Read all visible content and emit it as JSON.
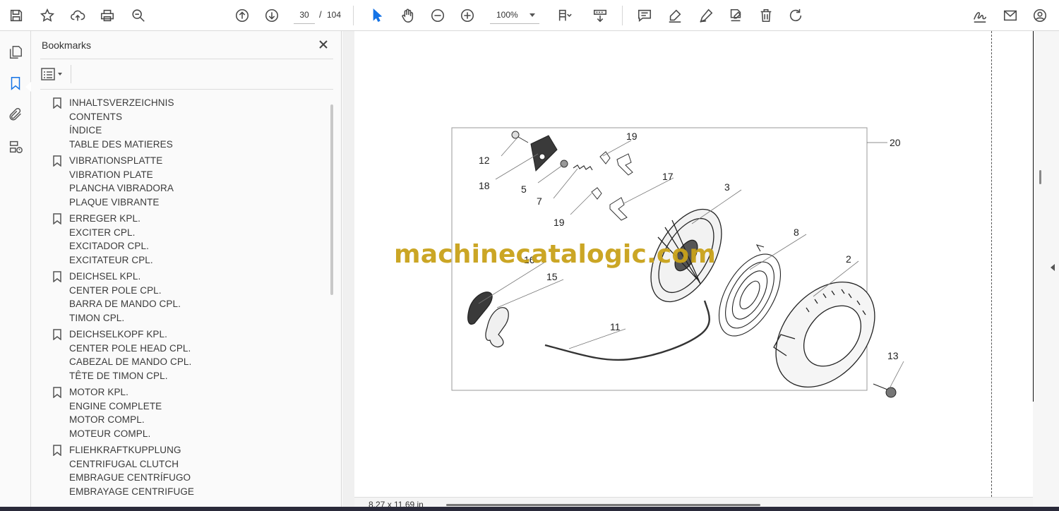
{
  "toolbar": {
    "page_current": "30",
    "page_separator": "/",
    "page_total": "104",
    "zoom": "100%"
  },
  "panel": {
    "title": "Bookmarks"
  },
  "bookmarks": [
    {
      "lines": [
        "INHALTSVERZEICHNIS",
        "CONTENTS",
        "ÍNDICE",
        "TABLE DES MATIERES"
      ]
    },
    {
      "lines": [
        "VIBRATIONSPLATTE",
        "VIBRATION PLATE",
        "PLANCHA VIBRADORA",
        "PLAQUE VIBRANTE"
      ]
    },
    {
      "lines": [
        "ERREGER KPL.",
        "EXCITER CPL.",
        "EXCITADOR CPL.",
        "EXCITATEUR CPL."
      ]
    },
    {
      "lines": [
        "DEICHSEL KPL.",
        "CENTER POLE CPL.",
        "BARRA DE MANDO CPL.",
        "TIMON CPL."
      ]
    },
    {
      "lines": [
        "DEICHSELKOPF KPL.",
        "CENTER POLE HEAD CPL.",
        "CABEZAL DE MANDO CPL.",
        "TÊTE DE TIMON CPL."
      ]
    },
    {
      "lines": [
        "MOTOR KPL.",
        "ENGINE COMPLETE",
        "MOTOR COMPL.",
        "MOTEUR COMPL."
      ]
    },
    {
      "lines": [
        "FLIEHKRAFTKUPPLUNG",
        "CENTRIFUGAL CLUTCH",
        "EMBRAGUE CENTRÍFUGO",
        "EMBRAYAGE CENTRIFUGE"
      ]
    }
  ],
  "document": {
    "watermark": "machinecatalogic.com",
    "page_size": "8,27 x 11,69 in",
    "callouts": [
      "12",
      "18",
      "5",
      "7",
      "19",
      "19",
      "17",
      "3",
      "20",
      "8",
      "2",
      "16",
      "15",
      "11",
      "13"
    ]
  },
  "icons": {
    "toolbar": [
      "save-icon",
      "star-icon",
      "cloud-upload-icon",
      "print-icon",
      "zoom-out-magnifier-icon",
      "arrow-up-circle-icon",
      "arrow-down-circle-icon",
      "pointer-icon",
      "hand-icon",
      "zoom-minus-icon",
      "zoom-plus-icon",
      "fit-page-icon",
      "scroll-mode-icon",
      "comment-icon",
      "highlight-pen-icon",
      "draw-icon",
      "stamp-icon",
      "trash-icon",
      "rotate-icon",
      "sign-icon",
      "mail-icon",
      "account-icon"
    ],
    "rail": [
      "pages-icon",
      "bookmark-icon",
      "attachment-icon",
      "layers-icon"
    ]
  }
}
